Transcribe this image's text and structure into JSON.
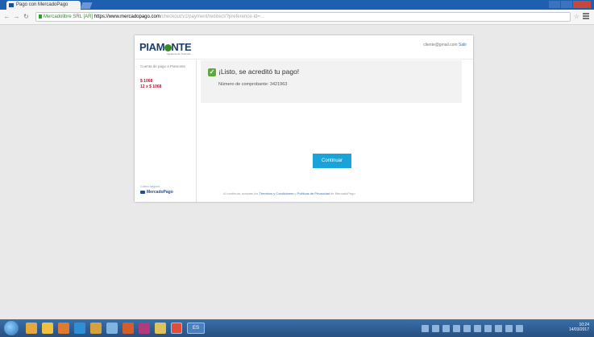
{
  "browser": {
    "tab_title": "Pago con MercadoPago",
    "url_secure": "Mercadolibre SRL [AR]",
    "url_host": "https://www.mercadopago.com",
    "url_path": "/checkout/v1/payment/redirect/?preference-id=..."
  },
  "header": {
    "logo_text": "PIAM",
    "logo_text_end": "NTE",
    "logo_tag": "zapatería de Tucumán",
    "user_email": "cliente@gmail.com",
    "logout_label": "Salir"
  },
  "sidebar": {
    "label": "Cuenta de pago a Piamonte",
    "amount": "$ 1068",
    "installments": "12 x $ 1068",
    "powered_label": "Cobro seguro",
    "provider": "MercadoPago"
  },
  "success": {
    "title": "¡Listo, se acreditó tu pago!",
    "subtitle": "Número de comprobante: 3421963"
  },
  "continue_label": "Continuar",
  "footnote": {
    "text": "Al continuar, aceptas los",
    "link1": "Términos y Condiciones",
    "sep": " y ",
    "link2": "Políticas de Privacidad",
    "end": " de MercadoPago"
  },
  "taskbar": {
    "search_label": "ES",
    "time": "10:24",
    "date": "14/03/2017"
  },
  "colors": {
    "accent": "#19a3d8",
    "success": "#5fa83b",
    "brand": "#1d3e66",
    "price": "#c8102e"
  }
}
